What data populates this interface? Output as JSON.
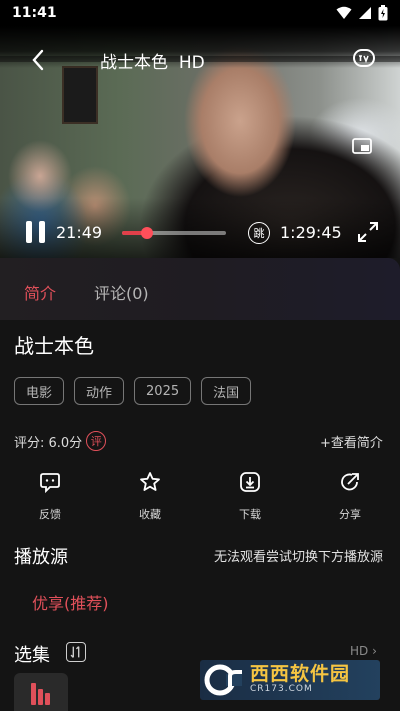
{
  "status_bar": {
    "time": "11:41"
  },
  "player": {
    "title": "战士本色",
    "quality_badge": "HD",
    "current_time": "21:49",
    "total_time": "1:29:45",
    "progress": 0.24,
    "skip_label": "跳"
  },
  "tabs": [
    {
      "label": "简介",
      "active": true
    },
    {
      "label": "评论(0)",
      "active": false
    }
  ],
  "movie": {
    "title": "战士本色",
    "tags": [
      "电影",
      "动作",
      "2025",
      "法国"
    ],
    "rating_label": "评分: 6.0分",
    "rating_badge": "评",
    "more_intro": "+查看简介"
  },
  "actions": [
    {
      "label": "反馈",
      "icon": "feedback-icon"
    },
    {
      "label": "收藏",
      "icon": "star-icon"
    },
    {
      "label": "下载",
      "icon": "download-icon"
    },
    {
      "label": "分享",
      "icon": "share-icon"
    }
  ],
  "sources": {
    "heading": "播放源",
    "hint": "无法观看尝试切换下方播放源",
    "items": [
      "优享(推荐)"
    ]
  },
  "episodes": {
    "heading": "选集",
    "quality": "HD"
  },
  "watermark": {
    "brand": "西西软件园",
    "domain": "CR173.COM"
  },
  "colors": {
    "accent": "#e0505a",
    "background": "#141414"
  }
}
